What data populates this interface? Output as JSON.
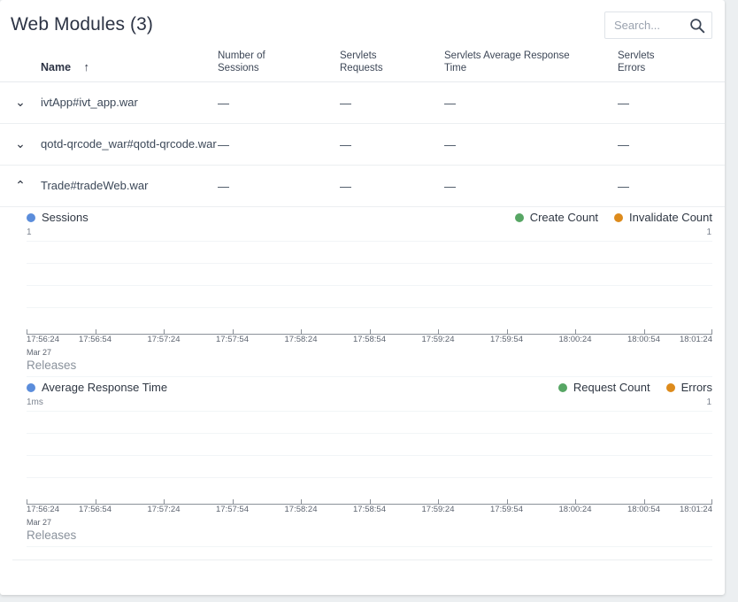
{
  "header": {
    "title": "Web Modules (3)",
    "search": {
      "placeholder": "Search...",
      "value": "",
      "icon": "search-icon"
    }
  },
  "table": {
    "columns": [
      {
        "id": "expand",
        "label": ""
      },
      {
        "id": "name",
        "label": "Name",
        "sorted": "asc",
        "sort_icon": "↑"
      },
      {
        "id": "sessions",
        "label": "Number of Sessions"
      },
      {
        "id": "servlets_requests",
        "label": "Servlets Requests"
      },
      {
        "id": "servlets_avg_response",
        "label": "Servlets Average Response Time"
      },
      {
        "id": "servlets_errors",
        "label": "Servlets Errors"
      }
    ],
    "rows": [
      {
        "name": "ivtApp#ivt_app.war",
        "expanded": false,
        "chevron": "⌄",
        "sessions": "—",
        "servlets_requests": "—",
        "servlets_avg_response": "—",
        "servlets_errors": "—"
      },
      {
        "name": "qotd-qrcode_war#qotd-qrcode.war",
        "expanded": false,
        "chevron": "⌄",
        "sessions": "—",
        "servlets_requests": "—",
        "servlets_avg_response": "—",
        "servlets_errors": "—"
      },
      {
        "name": "Trade#tradeWeb.war",
        "expanded": true,
        "chevron": "⌃",
        "sessions": "—",
        "servlets_requests": "—",
        "servlets_avg_response": "—",
        "servlets_errors": "—"
      }
    ]
  },
  "colors": {
    "series_blue": "#5b8ddb",
    "series_green": "#57a664",
    "series_orange": "#dd8b1c",
    "title": "#2c3344",
    "grid": "#f2f5f7",
    "axis": "#8b9199"
  },
  "chart_data": [
    {
      "type": "line",
      "title": "Sessions",
      "legend_position": "top",
      "grid": true,
      "legend": [
        {
          "label": "Sessions",
          "color": "#5b8ddb",
          "axis": "left"
        },
        {
          "label": "Create Count",
          "color": "#57a664",
          "axis": "right"
        },
        {
          "label": "Invalidate Count",
          "color": "#dd8b1c",
          "axis": "right"
        }
      ],
      "ylabel_left": "1",
      "ylabel_right": "1",
      "ylim_left": [
        0,
        1
      ],
      "ylim_right": [
        0,
        1
      ],
      "xlabel": "",
      "date_label": "Mar 27",
      "releases_label": "Releases",
      "x": [
        "17:56:24",
        "17:56:54",
        "17:57:24",
        "17:57:54",
        "17:58:24",
        "17:58:54",
        "17:59:24",
        "17:59:54",
        "18:00:24",
        "18:00:54",
        "18:01:24"
      ],
      "series": [
        {
          "name": "Sessions",
          "values": [
            0,
            0,
            0,
            0,
            0,
            0,
            0,
            0,
            0,
            0,
            0
          ]
        },
        {
          "name": "Create Count",
          "values": [
            0,
            0,
            0,
            0,
            0,
            0,
            0,
            0,
            0,
            0,
            0
          ]
        },
        {
          "name": "Invalidate Count",
          "values": [
            0,
            0,
            0,
            0,
            0,
            0,
            0,
            0,
            0,
            0,
            0
          ]
        }
      ],
      "gridline_count": 4
    },
    {
      "type": "line",
      "title": "Average Response Time",
      "legend_position": "top",
      "grid": true,
      "legend": [
        {
          "label": "Average Response Time",
          "color": "#5b8ddb",
          "axis": "left"
        },
        {
          "label": "Request Count",
          "color": "#57a664",
          "axis": "right"
        },
        {
          "label": "Errors",
          "color": "#dd8b1c",
          "axis": "right"
        }
      ],
      "ylabel_left": "1ms",
      "ylabel_right": "1",
      "ylim_left": [
        0,
        1
      ],
      "ylim_right": [
        0,
        1
      ],
      "xlabel": "",
      "date_label": "Mar 27",
      "releases_label": "Releases",
      "x": [
        "17:56:24",
        "17:56:54",
        "17:57:24",
        "17:57:54",
        "17:58:24",
        "17:58:54",
        "17:59:24",
        "17:59:54",
        "18:00:24",
        "18:00:54",
        "18:01:24"
      ],
      "series": [
        {
          "name": "Average Response Time",
          "values": [
            0,
            0,
            0,
            0,
            0,
            0,
            0,
            0,
            0,
            0,
            0
          ]
        },
        {
          "name": "Request Count",
          "values": [
            0,
            0,
            0,
            0,
            0,
            0,
            0,
            0,
            0,
            0,
            0
          ]
        },
        {
          "name": "Errors",
          "values": [
            0,
            0,
            0,
            0,
            0,
            0,
            0,
            0,
            0,
            0,
            0
          ]
        }
      ],
      "gridline_count": 4
    }
  ]
}
